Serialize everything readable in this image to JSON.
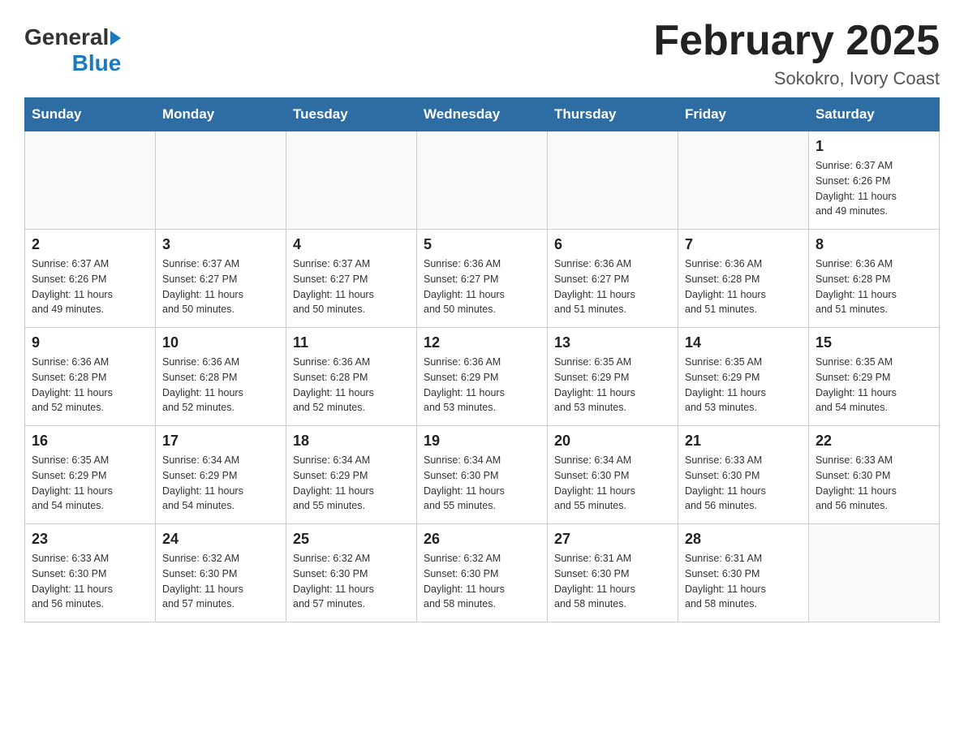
{
  "logo": {
    "text_general": "General",
    "text_blue": "Blue",
    "line2": "Blue"
  },
  "title": "February 2025",
  "subtitle": "Sokokro, Ivory Coast",
  "days_of_week": [
    "Sunday",
    "Monday",
    "Tuesday",
    "Wednesday",
    "Thursday",
    "Friday",
    "Saturday"
  ],
  "weeks": [
    [
      {
        "day": "",
        "info": ""
      },
      {
        "day": "",
        "info": ""
      },
      {
        "day": "",
        "info": ""
      },
      {
        "day": "",
        "info": ""
      },
      {
        "day": "",
        "info": ""
      },
      {
        "day": "",
        "info": ""
      },
      {
        "day": "1",
        "info": "Sunrise: 6:37 AM\nSunset: 6:26 PM\nDaylight: 11 hours\nand 49 minutes."
      }
    ],
    [
      {
        "day": "2",
        "info": "Sunrise: 6:37 AM\nSunset: 6:26 PM\nDaylight: 11 hours\nand 49 minutes."
      },
      {
        "day": "3",
        "info": "Sunrise: 6:37 AM\nSunset: 6:27 PM\nDaylight: 11 hours\nand 50 minutes."
      },
      {
        "day": "4",
        "info": "Sunrise: 6:37 AM\nSunset: 6:27 PM\nDaylight: 11 hours\nand 50 minutes."
      },
      {
        "day": "5",
        "info": "Sunrise: 6:36 AM\nSunset: 6:27 PM\nDaylight: 11 hours\nand 50 minutes."
      },
      {
        "day": "6",
        "info": "Sunrise: 6:36 AM\nSunset: 6:27 PM\nDaylight: 11 hours\nand 51 minutes."
      },
      {
        "day": "7",
        "info": "Sunrise: 6:36 AM\nSunset: 6:28 PM\nDaylight: 11 hours\nand 51 minutes."
      },
      {
        "day": "8",
        "info": "Sunrise: 6:36 AM\nSunset: 6:28 PM\nDaylight: 11 hours\nand 51 minutes."
      }
    ],
    [
      {
        "day": "9",
        "info": "Sunrise: 6:36 AM\nSunset: 6:28 PM\nDaylight: 11 hours\nand 52 minutes."
      },
      {
        "day": "10",
        "info": "Sunrise: 6:36 AM\nSunset: 6:28 PM\nDaylight: 11 hours\nand 52 minutes."
      },
      {
        "day": "11",
        "info": "Sunrise: 6:36 AM\nSunset: 6:28 PM\nDaylight: 11 hours\nand 52 minutes."
      },
      {
        "day": "12",
        "info": "Sunrise: 6:36 AM\nSunset: 6:29 PM\nDaylight: 11 hours\nand 53 minutes."
      },
      {
        "day": "13",
        "info": "Sunrise: 6:35 AM\nSunset: 6:29 PM\nDaylight: 11 hours\nand 53 minutes."
      },
      {
        "day": "14",
        "info": "Sunrise: 6:35 AM\nSunset: 6:29 PM\nDaylight: 11 hours\nand 53 minutes."
      },
      {
        "day": "15",
        "info": "Sunrise: 6:35 AM\nSunset: 6:29 PM\nDaylight: 11 hours\nand 54 minutes."
      }
    ],
    [
      {
        "day": "16",
        "info": "Sunrise: 6:35 AM\nSunset: 6:29 PM\nDaylight: 11 hours\nand 54 minutes."
      },
      {
        "day": "17",
        "info": "Sunrise: 6:34 AM\nSunset: 6:29 PM\nDaylight: 11 hours\nand 54 minutes."
      },
      {
        "day": "18",
        "info": "Sunrise: 6:34 AM\nSunset: 6:29 PM\nDaylight: 11 hours\nand 55 minutes."
      },
      {
        "day": "19",
        "info": "Sunrise: 6:34 AM\nSunset: 6:30 PM\nDaylight: 11 hours\nand 55 minutes."
      },
      {
        "day": "20",
        "info": "Sunrise: 6:34 AM\nSunset: 6:30 PM\nDaylight: 11 hours\nand 55 minutes."
      },
      {
        "day": "21",
        "info": "Sunrise: 6:33 AM\nSunset: 6:30 PM\nDaylight: 11 hours\nand 56 minutes."
      },
      {
        "day": "22",
        "info": "Sunrise: 6:33 AM\nSunset: 6:30 PM\nDaylight: 11 hours\nand 56 minutes."
      }
    ],
    [
      {
        "day": "23",
        "info": "Sunrise: 6:33 AM\nSunset: 6:30 PM\nDaylight: 11 hours\nand 56 minutes."
      },
      {
        "day": "24",
        "info": "Sunrise: 6:32 AM\nSunset: 6:30 PM\nDaylight: 11 hours\nand 57 minutes."
      },
      {
        "day": "25",
        "info": "Sunrise: 6:32 AM\nSunset: 6:30 PM\nDaylight: 11 hours\nand 57 minutes."
      },
      {
        "day": "26",
        "info": "Sunrise: 6:32 AM\nSunset: 6:30 PM\nDaylight: 11 hours\nand 58 minutes."
      },
      {
        "day": "27",
        "info": "Sunrise: 6:31 AM\nSunset: 6:30 PM\nDaylight: 11 hours\nand 58 minutes."
      },
      {
        "day": "28",
        "info": "Sunrise: 6:31 AM\nSunset: 6:30 PM\nDaylight: 11 hours\nand 58 minutes."
      },
      {
        "day": "",
        "info": ""
      }
    ]
  ]
}
